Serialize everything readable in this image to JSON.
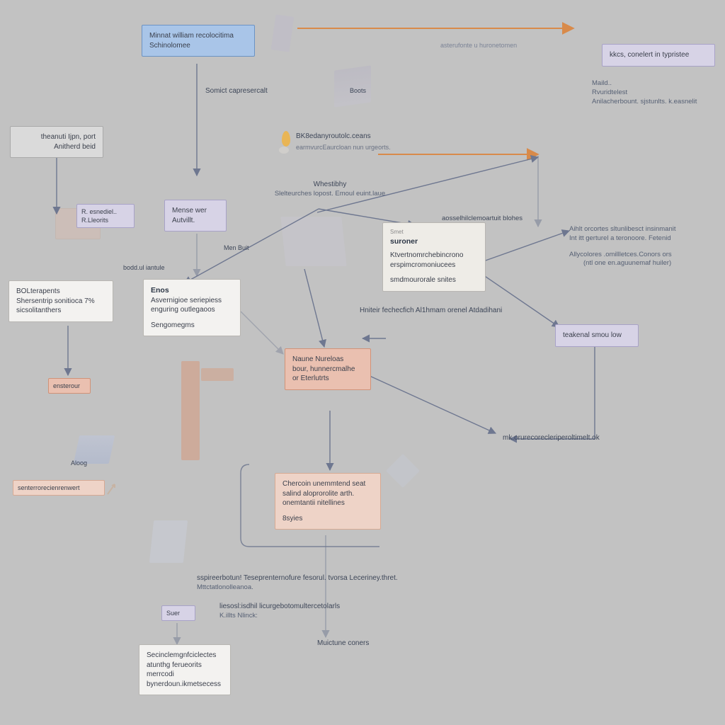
{
  "nodes": {
    "top_blue": {
      "title": "Minnat william recolocitima",
      "line1": "Schinolomee"
    },
    "tl_grey": {
      "line1": "theanuti Ijpn, port",
      "line2": "Anitherd beid"
    },
    "mid_left_lav_small": {
      "line1": "R. esnediel..",
      "line2": "R.Lleorits"
    },
    "mid_left_lav": {
      "line1": "Mense wer",
      "line2": "Autvillt."
    },
    "left_white": {
      "title": "BOLterapents",
      "line1": "Shersentrip sonitioca 7%",
      "line2": "sicsolitanthers"
    },
    "left_mid_white": {
      "title": "Enos",
      "line1": "Asvernigioe seriepiess",
      "line2": "enguring outlegaoos",
      "line3": "Sengomegms"
    },
    "center_card": {
      "tag": "Smet",
      "title": "suroner",
      "line1": "Ktvertnomrchebincrono",
      "line2": "erspimcromoniucees",
      "line3": "smdmourorale snites"
    },
    "center_peach": {
      "line1": "Naune Nureloas",
      "line2": "bour, hunnercmalhe",
      "line3": "or Eterlutrts"
    },
    "bottom_peach": {
      "line1": "Chercoin unemmtend seat",
      "line2": "salind aloprorolite arth.",
      "line3": "onemtantii nitellines",
      "line4": "8syies"
    },
    "bl_tiny_peach": {
      "line1": "ensterour"
    },
    "bl_tiny_peach2": {
      "line1": "senterrorecienrenwert"
    },
    "bl_lav": {
      "line1": "Suer"
    },
    "bl_white": {
      "line1": "Secinclemgnfciclectes",
      "line2": "atunthg ferueorits",
      "line3": "merrcodi",
      "line4": "bynerdoun.ikmetsecess"
    },
    "right_lav": {
      "line1": "teakenal smou low"
    },
    "top_right_lav": {
      "line1": "kkcs, conelert in typristee"
    }
  },
  "labels": {
    "top_arrow_sub": "asterufonte u huronetomen",
    "l1": "Somict capresercalt",
    "l_books": "Boots",
    "l_pin1": "BK8edanyroutolc.ceans",
    "l_pin2": "earmvurcEaurcloan nun urgeorts.",
    "l_center_above1": "Whestibhy",
    "l_center_above2": "Slelteurches lopost. Emoul euint.laue",
    "l_center_below": "Hniteir fechecfich Al1hmam orenel Atdadihani",
    "l_hook": "aosselhilclemoartuit blohes",
    "l_left_tiny": "bodd.ul iantule",
    "l_left_tiny2": "Men Buit",
    "l_mid_small": "Aloog",
    "l_right_block1": "Aihlt orcortes sltunlibesct insinmanit",
    "l_right_block2": "Int itt gerturel a teronoore. Fetenid",
    "l_right_block3": "Allycolores .omillletces.Conors ors",
    "l_right_block4": "(ntl one en.aguunemaf huiler)",
    "l_top_right1": "Maild..",
    "l_top_right2": "Rvuridtelest",
    "l_top_right3": "Anilacherbount. sjstunlts. k.easnelit",
    "l_right_down": "mk.orurecorecleriperoltimelt.ok",
    "l_bottom1": "sspireerbotun! Teseprenternofure fesorul. tvorsa Leceriney.thret.",
    "l_bottom1b": "Mttctatlonolleanoa.",
    "l_bottom2": "liesosl:isdhil licurgebotomultercetolarls",
    "l_bottom2b": "K.illts    Nlinck:",
    "l_bottom3": "Muictune coners"
  },
  "colors": {
    "bg": "#c2c2c2",
    "blue": "#a9c5e8",
    "lavender": "#d7d3e6",
    "peach": "#eac0b0",
    "orange_arrow": "#d88a4a"
  }
}
